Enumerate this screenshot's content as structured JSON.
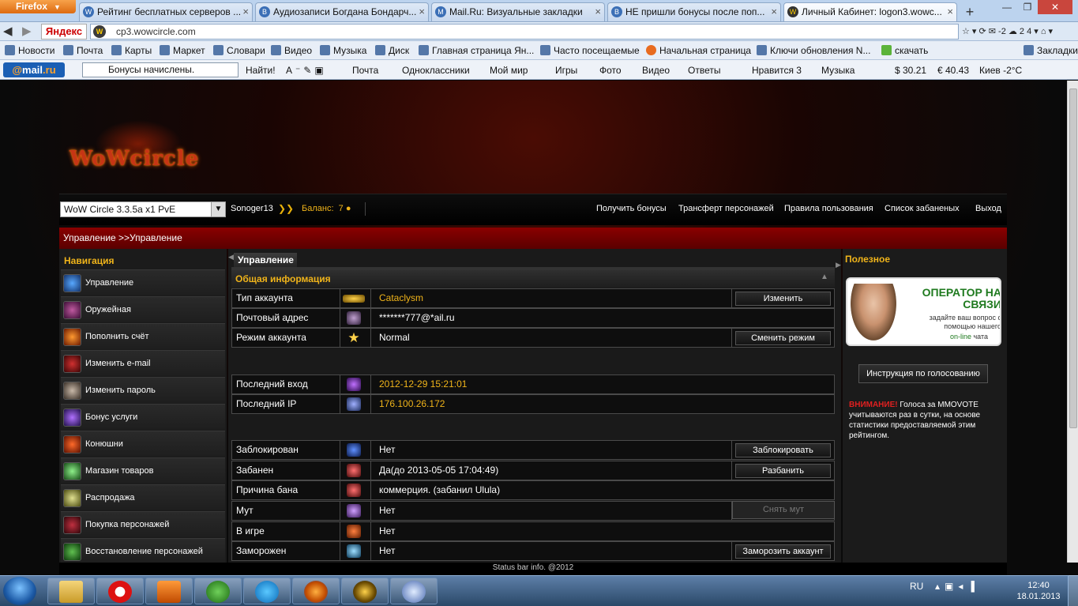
{
  "browser": {
    "firefox_label": "Firefox",
    "tabs": [
      {
        "title": "Рейтинг бесплатных серверов ...",
        "close": "×"
      },
      {
        "title": "Аудиозаписи Богдана Бондарч...",
        "close": "×"
      },
      {
        "title": "Mail.Ru: Визуальные закладки",
        "close": "×"
      },
      {
        "title": "НЕ пришли бонусы после поп...",
        "close": "×"
      },
      {
        "title": "Личный Кабинет: logon3.wowc...",
        "close": "×"
      }
    ],
    "new_tab": "+",
    "window_buttons": [
      "—",
      "❐",
      "✕"
    ],
    "yandex": "Яндекс",
    "url": "cp3.wowcircle.com",
    "nav_right": "☆ ▾ ⟳   ✉ -2  ☁ 2  4 ▾ ⌂ ▾",
    "bookmarks": [
      "Новости",
      "Почта",
      "Карты",
      "Маркет",
      "Словари",
      "Видео",
      "Музыка",
      "Диск",
      "Главная страница Ян...",
      "Часто посещаемые",
      "Начальная страница",
      "Ключи обновления N...",
      "скачать",
      "Закладки"
    ],
    "mailbar": {
      "logo_prefix": "@",
      "logo_main": "mail",
      "logo_suffix": ".ru",
      "search_value": "Бонусы начислены.",
      "find": "Найти!",
      "items": [
        "Почта",
        "Одноклассники",
        "Мой мир",
        "Игры",
        "Фото",
        "Видео",
        "Ответы",
        "Нравится 3",
        "Музыка",
        "$ 30.21",
        "€ 40.43",
        "Киев -2°C"
      ]
    }
  },
  "site": {
    "logo": "WoWcircle",
    "realm": "WoW Circle 3.3.5a x1 PvE",
    "username": "Sonoger13",
    "balance_label": "Баланс:",
    "balance_value": "7",
    "top_links": [
      "Получить бонусы",
      "Трансферт персонажей",
      "Правила пользования",
      "Список забаненых",
      "Выход"
    ],
    "breadcrumb": "Управление >>Управление",
    "nav_title": "Навигация",
    "nav_items": [
      "Управление",
      "Оружейная",
      "Пополнить счёт",
      "Изменить e-mail",
      "Изменить пароль",
      "Бонус услуги",
      "Конюшни",
      "Магазин товаров",
      "Распродажа",
      "Покупка персонажей",
      "Восстановление персонажей"
    ],
    "center_tab": "Управление",
    "section_title": "Общая информация",
    "rows": [
      {
        "label": "Тип аккаунта",
        "value": "Cataclysm",
        "button": "Изменить"
      },
      {
        "label": "Почтовый адрес",
        "value": "*******777@*ail.ru"
      },
      {
        "label": "Режим аккаунта",
        "value": "Normal",
        "button": "Сменить режим"
      },
      {
        "label": "Последний вход",
        "value": "2012-12-29 15:21:01"
      },
      {
        "label": "Последний IP",
        "value": "176.100.26.172"
      },
      {
        "label": "Заблокирован",
        "value": "Нет",
        "button": "Заблокировать"
      },
      {
        "label": "Забанен",
        "value": "Да(до 2013-05-05 17:04:49)",
        "button": "Разбанить"
      },
      {
        "label": "Причина бана",
        "value": "коммерция. (забанил Ulula)"
      },
      {
        "label": "Мут",
        "value": "Нет",
        "button": "Снять мут"
      },
      {
        "label": "В игре",
        "value": "Нет"
      },
      {
        "label": "Заморожен",
        "value": "Нет",
        "button": "Заморозить аккаунт"
      }
    ],
    "right_title": "Полезное",
    "banner": {
      "line1": "ОПЕРАТОР НА СВЯЗИ",
      "line2": "задайте ваш вопрос с помощью нашего",
      "line3_a": "on-line",
      "line3_b": " чата"
    },
    "vote_button": "Инструкция по голосованию",
    "notice_bold": "ВНИМАНИЕ!",
    "notice_text": " Голоса за MMOVOTE учитываются раз в сутки, на основе статистики предоставляемой этим рейтингом.",
    "status_bar": "Status bar info. @2012"
  },
  "taskbar": {
    "lang": "RU",
    "time": "12:40",
    "date": "18.01.2013"
  },
  "colors": {
    "accent_gold": "#f0b41a",
    "breadcrumb_red": "#8a0000",
    "notice_red": "#e02020"
  }
}
